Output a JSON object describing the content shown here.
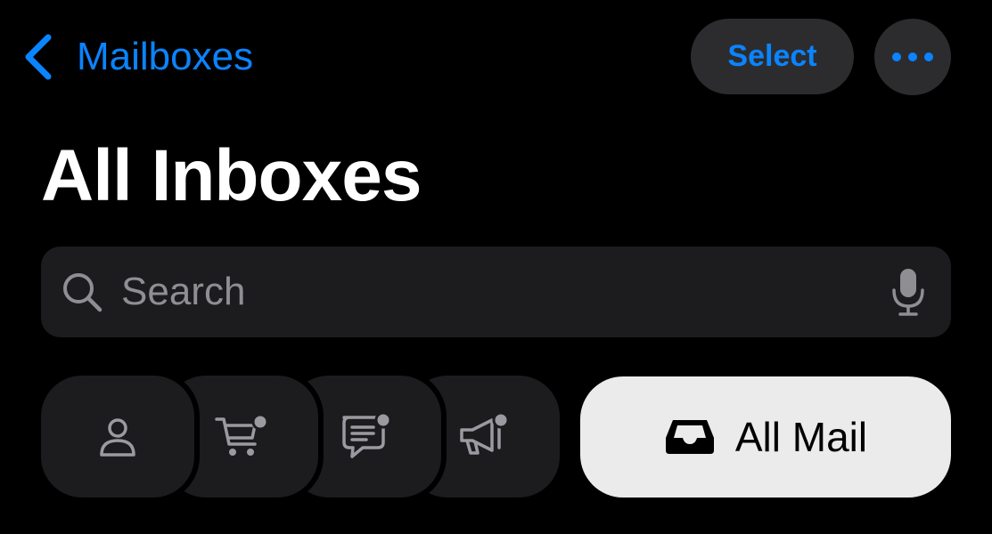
{
  "nav": {
    "back_label": "Mailboxes",
    "select_label": "Select"
  },
  "title": "All Inboxes",
  "search": {
    "placeholder": "Search",
    "value": ""
  },
  "categories": [
    {
      "icon": "person-icon",
      "has_badge": false
    },
    {
      "icon": "shopping-cart-icon",
      "has_badge": true
    },
    {
      "icon": "message-icon",
      "has_badge": true
    },
    {
      "icon": "megaphone-icon",
      "has_badge": true
    }
  ],
  "all_mail": {
    "icon": "inbox-tray-icon",
    "label": "All Mail",
    "selected": true
  },
  "colors": {
    "accent": "#0a84ff",
    "background": "#000000",
    "control": "#2c2c2e",
    "field": "#1c1c1e",
    "selected_pill": "#ebebeb",
    "icon_gray": "#9a9aa0",
    "placeholder": "#8e8e93"
  }
}
